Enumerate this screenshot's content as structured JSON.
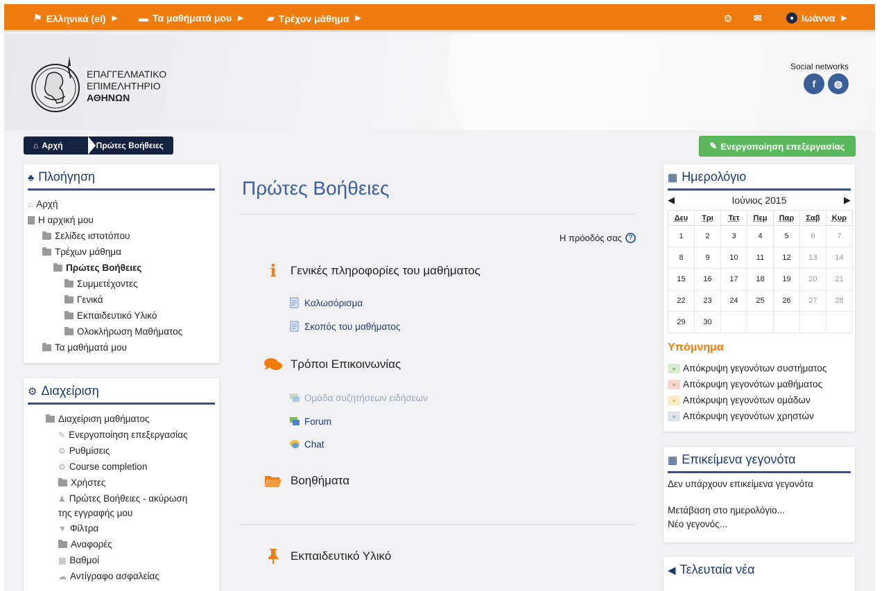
{
  "topnav": {
    "language": "Ελληνικά (el)",
    "my_courses": "Τα μαθήματά μου",
    "current_course": "Τρέχον μάθημα",
    "user": "Ιωάννα"
  },
  "header": {
    "logo_line1": "ΕΠΑΓΓΕΛΜΑΤΙΚΟ",
    "logo_line2": "ΕΠΙΜΕΛΗΤΗΡΙΟ",
    "logo_line3": "ΑΘΗΝΩΝ",
    "social_label": "Social networks",
    "social_facebook": "f"
  },
  "breadcrumb": {
    "home": "Αρχή",
    "current": "Πρώτες Βοήθειες"
  },
  "edit_button": "Ενεργοποίηση επεξεργασίας",
  "navigation": {
    "title": "Πλοήγηση",
    "items": [
      {
        "label": "Αρχή"
      },
      {
        "label": "Η αρχική μου"
      },
      {
        "label": "Σελίδες ιστοτόπου"
      },
      {
        "label": "Τρέχων μάθημα"
      },
      {
        "label": "Πρώτες Βοήθειες"
      },
      {
        "label": "Συμμετέχοντες"
      },
      {
        "label": "Γενικά"
      },
      {
        "label": "Εκπαιδευτικό Υλικό"
      },
      {
        "label": "Ολοκλήρωση Μαθήματος"
      },
      {
        "label": "Τα μαθήματά μου"
      }
    ]
  },
  "administration": {
    "title": "Διαχείριση",
    "items": [
      {
        "label": "Διαχείριση μαθήματος"
      },
      {
        "label": "Ενεργοποίηση επεξεργασίας"
      },
      {
        "label": "Ρυθμίσεις"
      },
      {
        "label": "Course completion"
      },
      {
        "label": "Χρήστες"
      },
      {
        "label": "Πρώτες Βοήθειες - ακύρωση"
      },
      {
        "label": "της εγγραφής μου"
      },
      {
        "label": "Φίλτρα"
      },
      {
        "label": "Αναφορές"
      },
      {
        "label": "Βαθμοί"
      },
      {
        "label": "Αντίγραφο ασφαλείας"
      }
    ]
  },
  "main": {
    "title": "Πρώτες Βοήθειες",
    "progress_label": "Η πρόοδός σας",
    "sections": [
      {
        "title": "Γενικές πληροφορίες του μαθήματος"
      },
      {
        "title": "Τρόποι Επικοινωνίας"
      },
      {
        "title": "Βοηθήματα"
      },
      {
        "title": "Εκπαιδευτικό Υλικό"
      }
    ],
    "activities": [
      {
        "label": "Καλωσόρισμα"
      },
      {
        "label": "Σκοπός του μαθήματος"
      },
      {
        "label": "Ομάδα συζητήσεων ειδήσεων"
      },
      {
        "label": "Forum"
      },
      {
        "label": "Chat"
      }
    ]
  },
  "calendar": {
    "title": "Ημερολόγιο",
    "month": "Ιούνιος 2015",
    "weekdays": [
      "Δευ",
      "Τρι",
      "Τετ",
      "Πεμ",
      "Παρ",
      "Σαβ",
      "Κυρ"
    ],
    "weeks": [
      [
        "1",
        "2",
        "3",
        "4",
        "5",
        "6",
        "7"
      ],
      [
        "8",
        "9",
        "10",
        "11",
        "12",
        "13",
        "14"
      ],
      [
        "15",
        "16",
        "17",
        "18",
        "19",
        "20",
        "21"
      ],
      [
        "22",
        "23",
        "24",
        "25",
        "26",
        "27",
        "28"
      ],
      [
        "29",
        "30",
        "",
        "",
        "",
        "",
        ""
      ]
    ],
    "legend_title": "Υπόμνημα",
    "legend": [
      {
        "label": "Απόκρυψη γεγονότων συστήματος",
        "color": "#d7ecd0"
      },
      {
        "label": "Απόκρυψη γεγονότων μαθήματος",
        "color": "#f6d6cf"
      },
      {
        "label": "Απόκρυψη γεγονότων ομάδων",
        "color": "#f8ecc4"
      },
      {
        "label": "Απόκρυψη γεγονότων χρηστών",
        "color": "#dde3ea"
      }
    ]
  },
  "upcoming": {
    "title": "Επικείμενα γεγονότα",
    "empty": "Δεν υπάρχουν επικείμενα γεγονότα",
    "goto_calendar": "Μετάβαση στο ημερολόγιο...",
    "new_event": "Νέο γεγονός..."
  },
  "news": {
    "title": "Τελευταία νέα"
  },
  "colors": {
    "brand_orange": "#f07c0e",
    "navy": "#14213f",
    "link_blue": "#1f3b6e",
    "edit_green": "#5cb85c"
  }
}
